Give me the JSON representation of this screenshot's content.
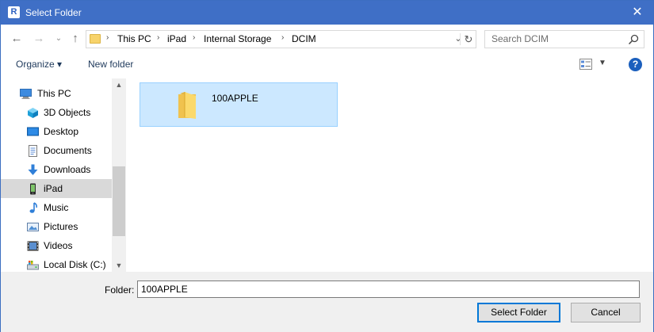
{
  "window": {
    "title": "Select Folder",
    "app_icon_letter": "R"
  },
  "address": {
    "breadcrumbs": [
      "This PC",
      "iPad",
      "Internal Storage",
      "DCIM"
    ]
  },
  "search": {
    "placeholder": "Search DCIM"
  },
  "toolbar": {
    "organize_label": "Organize ▾",
    "new_folder_label": "New folder",
    "help_label": "?"
  },
  "sidebar": {
    "items": [
      {
        "label": "This PC",
        "icon": "computer-icon",
        "selected": false
      },
      {
        "label": "3D Objects",
        "icon": "cube-icon",
        "selected": false
      },
      {
        "label": "Desktop",
        "icon": "desktop-icon",
        "selected": false
      },
      {
        "label": "Documents",
        "icon": "documents-icon",
        "selected": false
      },
      {
        "label": "Downloads",
        "icon": "download-arrow-icon",
        "selected": false
      },
      {
        "label": "iPad",
        "icon": "ipad-icon",
        "selected": true
      },
      {
        "label": "Music",
        "icon": "music-note-icon",
        "selected": false
      },
      {
        "label": "Pictures",
        "icon": "pictures-icon",
        "selected": false
      },
      {
        "label": "Videos",
        "icon": "videos-icon",
        "selected": false
      },
      {
        "label": "Local Disk (C:)",
        "icon": "local-disk-icon",
        "selected": false
      }
    ]
  },
  "content": {
    "items": [
      {
        "name": "100APPLE",
        "icon": "folder-icon",
        "selected": true
      }
    ]
  },
  "footer": {
    "folder_label": "Folder:",
    "folder_value": "100APPLE",
    "select_button": "Select Folder",
    "cancel_button": "Cancel"
  },
  "colors": {
    "titlebar": "#3f6fc6",
    "selection_bg": "#cce8ff",
    "selection_border": "#99d1ff",
    "primary_button_border": "#0078d7"
  }
}
